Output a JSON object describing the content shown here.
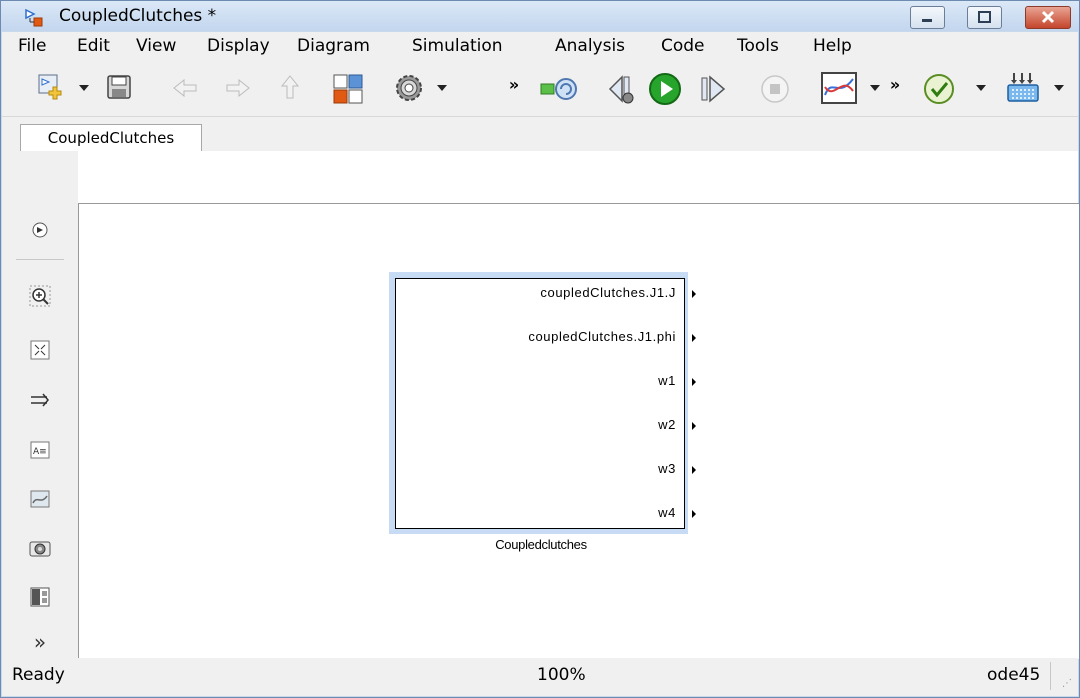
{
  "window": {
    "title": "CoupledClutches *"
  },
  "menubar": {
    "items": [
      "File",
      "Edit",
      "View",
      "Display",
      "Diagram",
      "Simulation",
      "Analysis",
      "Code",
      "Tools",
      "Help"
    ]
  },
  "tabs": [
    {
      "label": "CoupledClutches"
    }
  ],
  "block": {
    "ports": [
      "coupledClutches.J1.J",
      "coupledClutches.J1.phi",
      "w1",
      "w2",
      "w3",
      "w4"
    ],
    "name": "Coupledclutches"
  },
  "status": {
    "left": "Ready",
    "zoom": "100%",
    "solver": "ode45"
  },
  "colors": {
    "titlebar": "#c3d6ee",
    "selection": "#c7dbf5",
    "run_green": "#27a42b",
    "close_red": "#c4452c"
  }
}
